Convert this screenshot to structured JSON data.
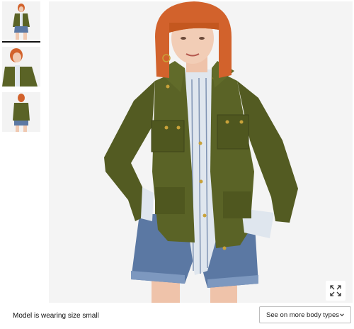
{
  "gallery": {
    "thumbnails": [
      {
        "icon": "product-photo-full-body",
        "selected": true
      },
      {
        "icon": "product-photo-upper-body",
        "selected": false
      },
      {
        "icon": "product-photo-back-view",
        "selected": false
      }
    ],
    "expand_icon": "expand-icon"
  },
  "footer": {
    "model_size_text": "Model is wearing size small",
    "body_types_label": "See on more body types",
    "dropdown_icon": "chevron-down-icon"
  },
  "colors": {
    "jacket": "#5a6326",
    "denim": "#5b78a3",
    "hair": "#d2622c",
    "background": "#f4f4f4"
  }
}
